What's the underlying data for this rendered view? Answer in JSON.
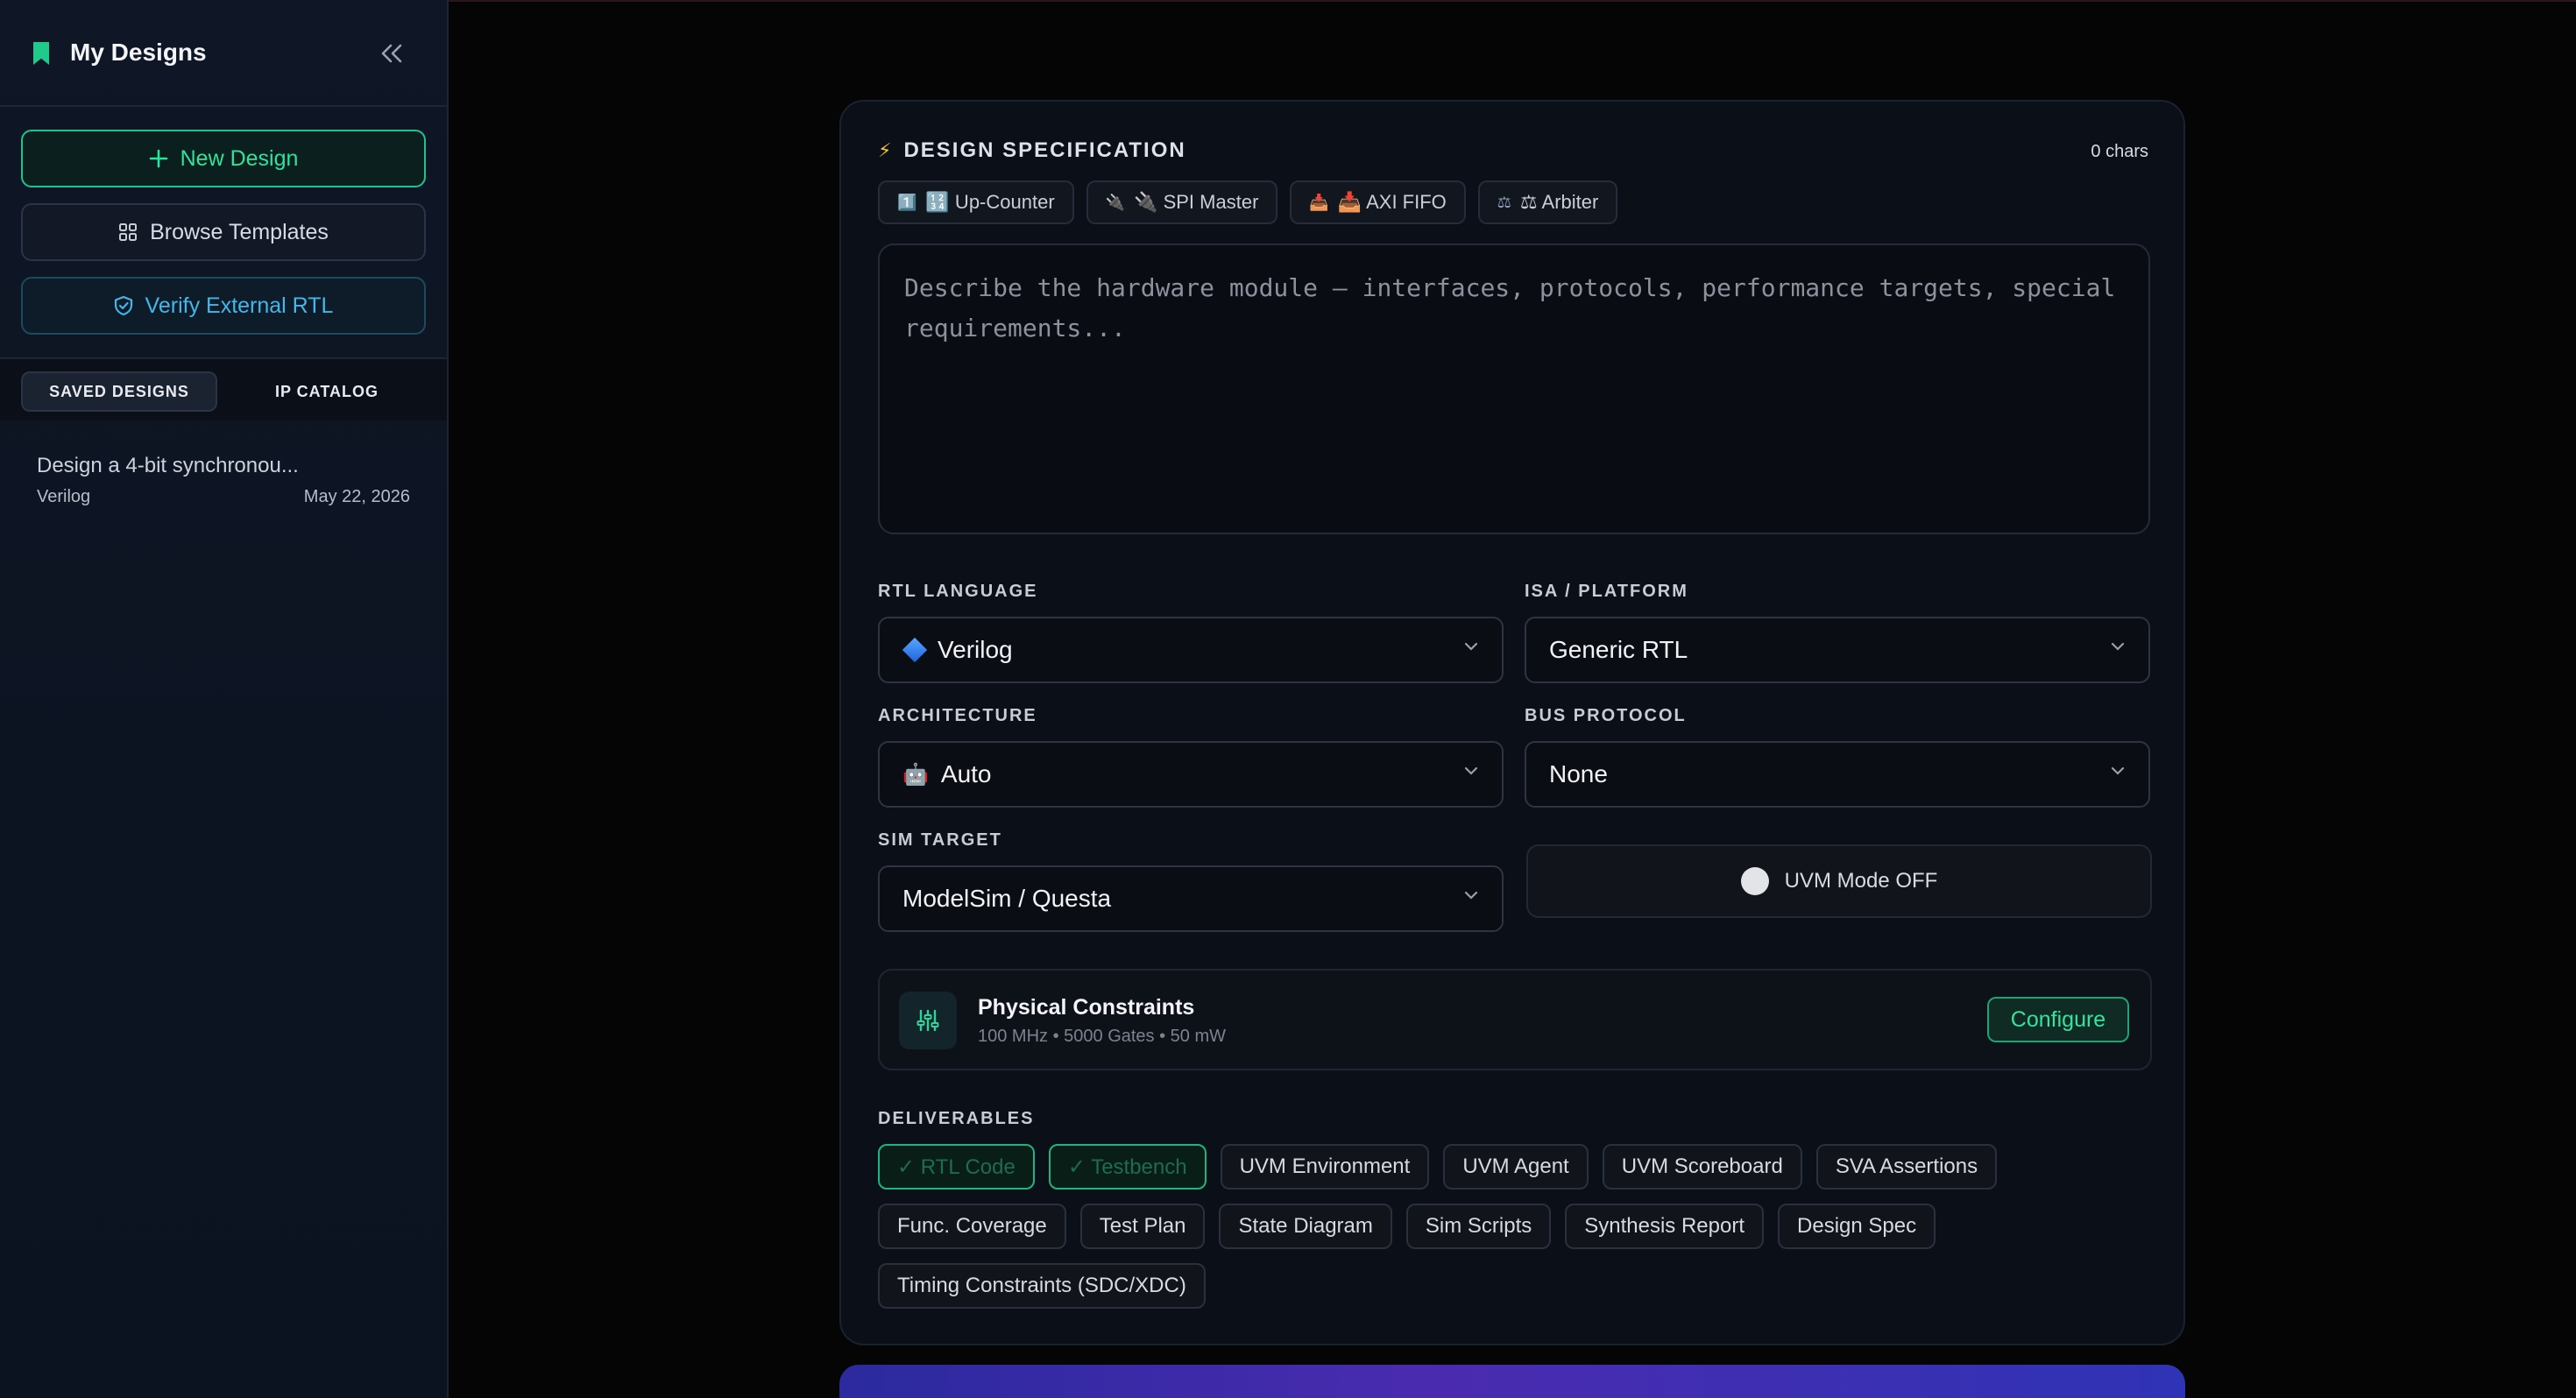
{
  "sidebar": {
    "title": "My Designs",
    "buttons": {
      "new_design": "New Design",
      "browse_templates": "Browse Templates",
      "verify_external": "Verify External RTL"
    },
    "tabs": [
      "SAVED DESIGNS",
      "IP CATALOG"
    ],
    "designs": [
      {
        "name": "Design a 4-bit synchronou...",
        "language": "Verilog",
        "date": "May 22, 2026"
      }
    ]
  },
  "spec": {
    "title": "DESIGN SPECIFICATION",
    "char_count": "0 chars",
    "templates": [
      {
        "icon": "1️⃣",
        "label": "🔢 Up-Counter"
      },
      {
        "icon": "🔌",
        "label": "🔌 SPI Master"
      },
      {
        "icon": "📥",
        "label": "📥 AXI FIFO"
      },
      {
        "icon": "⚖",
        "label": "⚖ Arbiter"
      }
    ],
    "placeholder": "Describe the hardware module — interfaces, protocols, performance targets, special requirements..."
  },
  "fields": {
    "rtl_language": {
      "label": "RTL LANGUAGE",
      "value": "Verilog"
    },
    "isa_platform": {
      "label": "ISA / PLATFORM",
      "value": "Generic RTL"
    },
    "architecture": {
      "label": "ARCHITECTURE",
      "value": "Auto"
    },
    "bus_protocol": {
      "label": "BUS PROTOCOL",
      "value": "None"
    },
    "sim_target": {
      "label": "SIM TARGET",
      "value": "ModelSim / Questa"
    }
  },
  "uvm": {
    "label": "UVM Mode OFF"
  },
  "constraints": {
    "title": "Physical Constraints",
    "summary": "100 MHz • 5000 Gates • 50 mW",
    "action": "Configure"
  },
  "deliverables": {
    "label": "DELIVERABLES",
    "items": [
      {
        "label": "✓ RTL Code",
        "selected": true
      },
      {
        "label": "✓ Testbench",
        "selected": true
      },
      {
        "label": "UVM Environment",
        "selected": false
      },
      {
        "label": "UVM Agent",
        "selected": false
      },
      {
        "label": "UVM Scoreboard",
        "selected": false
      },
      {
        "label": "SVA Assertions",
        "selected": false
      },
      {
        "label": "Func. Coverage",
        "selected": false
      },
      {
        "label": "Test Plan",
        "selected": false
      },
      {
        "label": "State Diagram",
        "selected": false
      },
      {
        "label": "Sim Scripts",
        "selected": false
      },
      {
        "label": "Synthesis Report",
        "selected": false
      },
      {
        "label": "Design Spec",
        "selected": false
      },
      {
        "label": "Timing Constraints (SDC/XDC)",
        "selected": false
      }
    ]
  },
  "colors": {
    "accent": "#21c98a",
    "link": "#45b6e8",
    "background": "#050506"
  }
}
